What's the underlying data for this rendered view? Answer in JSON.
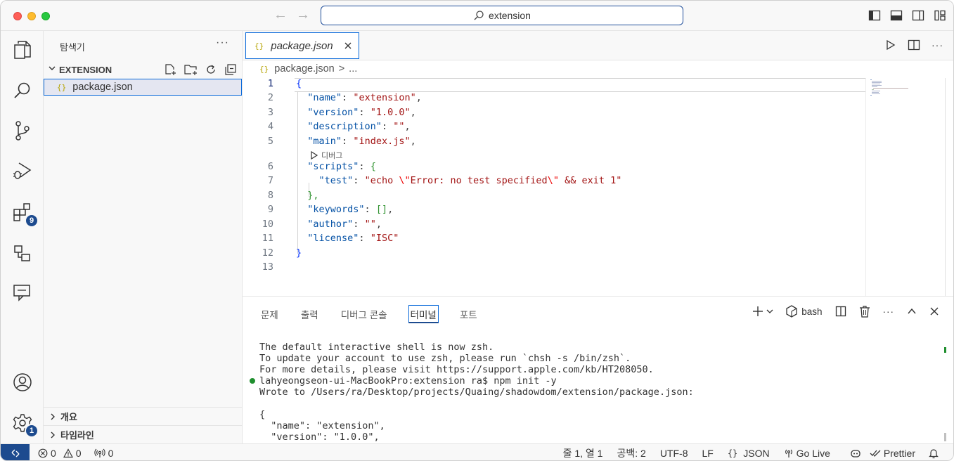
{
  "window": {
    "command_center_text": "extension"
  },
  "activity_bar": {
    "extensions_badge": "9",
    "settings_badge": "1"
  },
  "sidebar": {
    "title": "탐색기",
    "more": "···",
    "section": "EXTENSION",
    "files": [
      {
        "name": "package.json",
        "icon": "{}"
      }
    ],
    "bottom_sections": [
      "개요",
      "타임라인"
    ]
  },
  "editor": {
    "tab": {
      "icon": "{}",
      "label": "package.json"
    },
    "breadcrumb": {
      "file": "package.json",
      "sep": ">",
      "rest": "..."
    },
    "codelens": "디버그",
    "line_numbers": [
      "1",
      "2",
      "3",
      "4",
      "5",
      "6",
      "7",
      "8",
      "9",
      "10",
      "11",
      "12",
      "13"
    ],
    "code": {
      "l1": "{",
      "l2_key": "\"name\"",
      "l2_val": "\"extension\"",
      "l3_key": "\"version\"",
      "l3_val": "\"1.0.0\"",
      "l4_key": "\"description\"",
      "l4_val": "\"\"",
      "l5_key": "\"main\"",
      "l5_val": "\"index.js\"",
      "l6_key": "\"scripts\"",
      "l6_brace": "{",
      "l7_key": "\"test\"",
      "l7_v1": "\"echo ",
      "l7_esc1": "\\\"",
      "l7_v2": "Error: no test specified",
      "l7_esc2": "\\\"",
      "l7_v3": " && exit 1\"",
      "l8": "},",
      "l9_key": "\"keywords\"",
      "l9_val": "[]",
      "l10_key": "\"author\"",
      "l10_val": "\"\"",
      "l11_key": "\"license\"",
      "l11_val": "\"ISC\"",
      "l12": "}"
    }
  },
  "panel": {
    "tabs": [
      "문제",
      "출력",
      "디버그 콘솔",
      "터미널",
      "포트"
    ],
    "active_tab": "터미널",
    "shell": "bash",
    "terminal_lines": [
      "The default interactive shell is now zsh.",
      "To update your account to use zsh, please run `chsh -s /bin/zsh`.",
      "For more details, please visit https://support.apple.com/kb/HT208050.",
      "lahyeongseon-ui-MacBookPro:extension ra$ npm init -y",
      "Wrote to /Users/ra/Desktop/projects/Quaing/shadowdom/extension/package.json:",
      "",
      "{",
      "  \"name\": \"extension\",",
      "  \"version\": \"1.0.0\","
    ]
  },
  "statusbar": {
    "errors": "0",
    "warnings": "0",
    "ports": "0",
    "position": "줄 1, 열 1",
    "spaces": "공백: 2",
    "encoding": "UTF-8",
    "eol": "LF",
    "language": "JSON",
    "language_icon": "{}",
    "golive": "Go Live",
    "prettier": "Prettier"
  }
}
